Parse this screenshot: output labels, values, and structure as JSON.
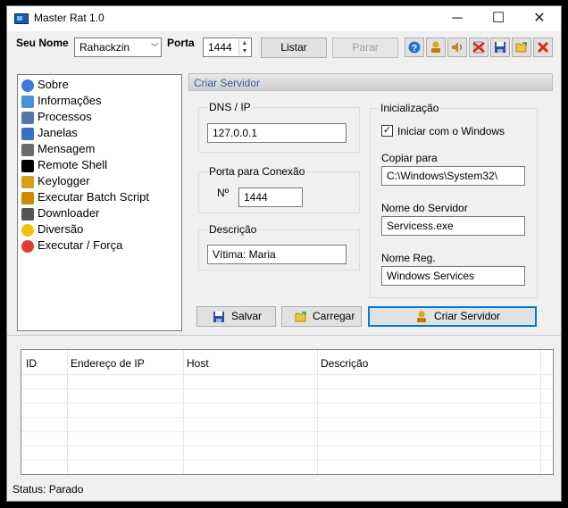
{
  "window": {
    "title": "Master Rat 1.0",
    "minimize": "─",
    "maximize": "☐",
    "close": "✕"
  },
  "toolbar": {
    "name_label": "Seu Nome",
    "name_value": "Rahackzin",
    "port_label": "Porta",
    "port_value": "1444",
    "list_button": "Listar",
    "stop_button": "Parar",
    "icons": [
      "help-icon",
      "builder-icon",
      "sound-icon",
      "delete-icon",
      "save-icon",
      "open-folder-icon",
      "close-icon"
    ]
  },
  "tree": {
    "items": [
      {
        "label": "Sobre",
        "icon": "help-icon",
        "color": "#3a7bd5"
      },
      {
        "label": "Informações",
        "icon": "computer-icon",
        "color": "#4a90d9"
      },
      {
        "label": "Processos",
        "icon": "list-icon",
        "color": "#5577aa"
      },
      {
        "label": "Janelas",
        "icon": "windows-icon",
        "color": "#3a6fc8"
      },
      {
        "label": "Mensagem",
        "icon": "message-icon",
        "color": "#6b6b6b"
      },
      {
        "label": "Remote Shell",
        "icon": "terminal-icon",
        "color": "#000000"
      },
      {
        "label": "Keylogger",
        "icon": "pen-icon",
        "color": "#d4a017"
      },
      {
        "label": "Executar Batch Script",
        "icon": "batch-icon",
        "color": "#cc8a00"
      },
      {
        "label": "Downloader",
        "icon": "phone-icon",
        "color": "#555555"
      },
      {
        "label": "Diversão",
        "icon": "smiley-icon",
        "color": "#f2c200"
      },
      {
        "label": "Executar / Força",
        "icon": "warning-icon",
        "color": "#e03c31"
      }
    ]
  },
  "panel": {
    "header": "Criar Servidor",
    "dns": {
      "label": "DNS / IP",
      "value": "127.0.0.1"
    },
    "port": {
      "label": "Porta para Conexão",
      "field_label": "Nº",
      "value": "1444"
    },
    "desc": {
      "label": "Descrição",
      "value": "Vítima: Maria"
    },
    "init": {
      "label": "Inicialização",
      "checkbox_label": "Iniciar com o Windows",
      "checked": true,
      "copy_label": "Copiar para",
      "copy_value": "C:\\Windows\\System32\\",
      "server_label": "Nome do Servidor",
      "server_value": "Servicess.exe",
      "reg_label": "Nome Reg.",
      "reg_value": "Windows Services"
    },
    "save_button": "Salvar",
    "load_button": "Carregar",
    "create_button": "Criar Servidor"
  },
  "listview": {
    "columns": [
      "ID",
      "Endereço de IP",
      "Host",
      "Descrição"
    ]
  },
  "status": {
    "text": "Status: Parado"
  },
  "colors": {
    "accent": "#0078d7",
    "panel_header": "#2f5fa8"
  }
}
